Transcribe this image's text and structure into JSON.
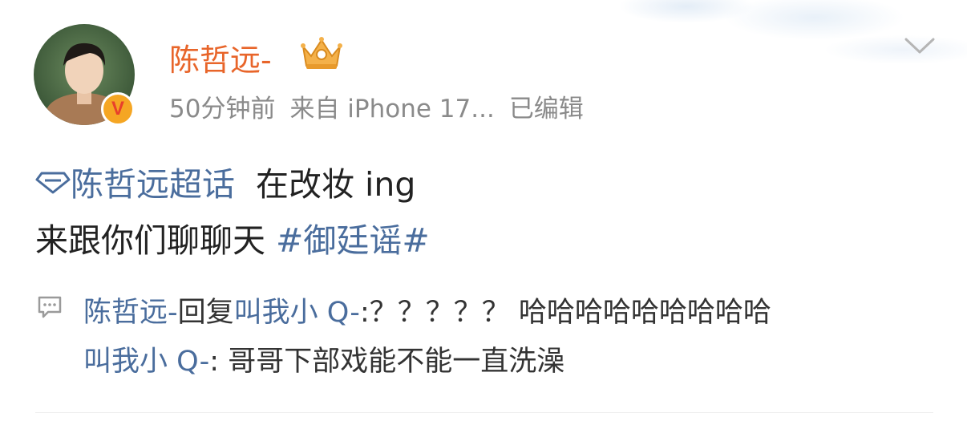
{
  "post": {
    "username": "陈哲远-",
    "time": "50分钟前",
    "source": "来自 iPhone 17...",
    "edited": "已编辑",
    "topic": "陈哲远超话",
    "text1": "在改妆 ing",
    "text2": "来跟你们聊聊天",
    "hashtag": "#御廷谣#",
    "verified_mark": "V"
  },
  "comments": [
    {
      "user": "陈哲远-",
      "action": "回复",
      "target": "叫我小 Q-",
      "text": ":？？？？？ 哈哈哈哈哈哈哈哈哈"
    },
    {
      "user": "叫我小 Q-",
      "text": ": 哥哥下部戏能不能一直洗澡"
    }
  ],
  "colors": {
    "username": "#e8652a",
    "link": "#4a6d9d",
    "meta": "#8a8a8a",
    "text": "#222222"
  },
  "icons": {
    "avatar": "avatar",
    "verified": "verified-badge",
    "member_crown": "crown-icon",
    "expand": "chevron-down-icon",
    "topic": "diamond-icon",
    "comment": "comment-icon"
  }
}
